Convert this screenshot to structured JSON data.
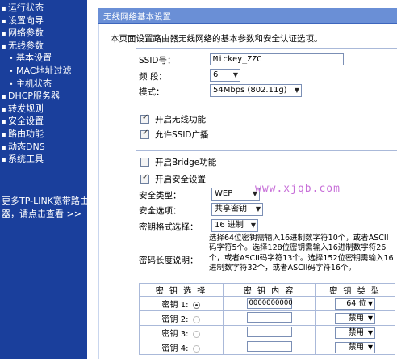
{
  "sidebar": {
    "items": [
      {
        "label": "运行状态",
        "sub": false
      },
      {
        "label": "设置向导",
        "sub": false
      },
      {
        "label": "网络参数",
        "sub": false
      },
      {
        "label": "无线参数",
        "sub": false
      },
      {
        "label": "基本设置",
        "sub": true
      },
      {
        "label": "MAC地址过滤",
        "sub": true
      },
      {
        "label": "主机状态",
        "sub": true
      },
      {
        "label": "DHCP服务器",
        "sub": false
      },
      {
        "label": "转发规则",
        "sub": false
      },
      {
        "label": "安全设置",
        "sub": false
      },
      {
        "label": "路由功能",
        "sub": false
      },
      {
        "label": "动态DNS",
        "sub": false
      },
      {
        "label": "系统工具",
        "sub": false
      }
    ],
    "promo_line1": "更多TP-LINK宽带路由",
    "promo_line2": "器，请点击查看 >>"
  },
  "panel": {
    "title": "无线网络基本设置",
    "description": "本页面设置路由器无线网络的基本参数和安全认证选项。"
  },
  "basic": {
    "ssid_label": "SSID号：",
    "ssid_value": "Mickey_ZZC",
    "channel_label": "频  段：",
    "channel_value": "6",
    "mode_label": "模式：",
    "mode_value": "54Mbps (802.11g)",
    "enable_wireless_label": "开启无线功能",
    "enable_wireless_checked": true,
    "broadcast_ssid_label": "允许SSID广播",
    "broadcast_ssid_checked": true
  },
  "security": {
    "bridge_label": "开启Bridge功能",
    "bridge_checked": false,
    "enable_security_label": "开启安全设置",
    "enable_security_checked": true,
    "type_label": "安全类型：",
    "type_value": "WEP",
    "option_label": "安全选项：",
    "option_value": "共享密钥",
    "format_label": "密钥格式选择：",
    "format_value": "16 进制",
    "keylen_label": "密码长度说明：",
    "keylen_text": "选择64位密钥需输入16进制数字符10个，或者ASCII码字符5个。选择128位密钥需输入16进制数字符26个，或者ASCII码字符13个。选择152位密钥需输入16进制数字符32个，或者ASCII码字符16个。"
  },
  "watermark": "www.xjqb.com",
  "keys_table": {
    "headers": [
      "密 钥 选 择",
      "密 钥 内 容",
      "密 钥 类 型"
    ],
    "rows": [
      {
        "label": "密钥 1:",
        "selected": true,
        "value": "0000000000",
        "type": "64 位"
      },
      {
        "label": "密钥 2:",
        "selected": false,
        "value": "",
        "type": "禁用"
      },
      {
        "label": "密钥 3:",
        "selected": false,
        "value": "",
        "type": "禁用"
      },
      {
        "label": "密钥 4:",
        "selected": false,
        "value": "",
        "type": "禁用"
      }
    ]
  }
}
